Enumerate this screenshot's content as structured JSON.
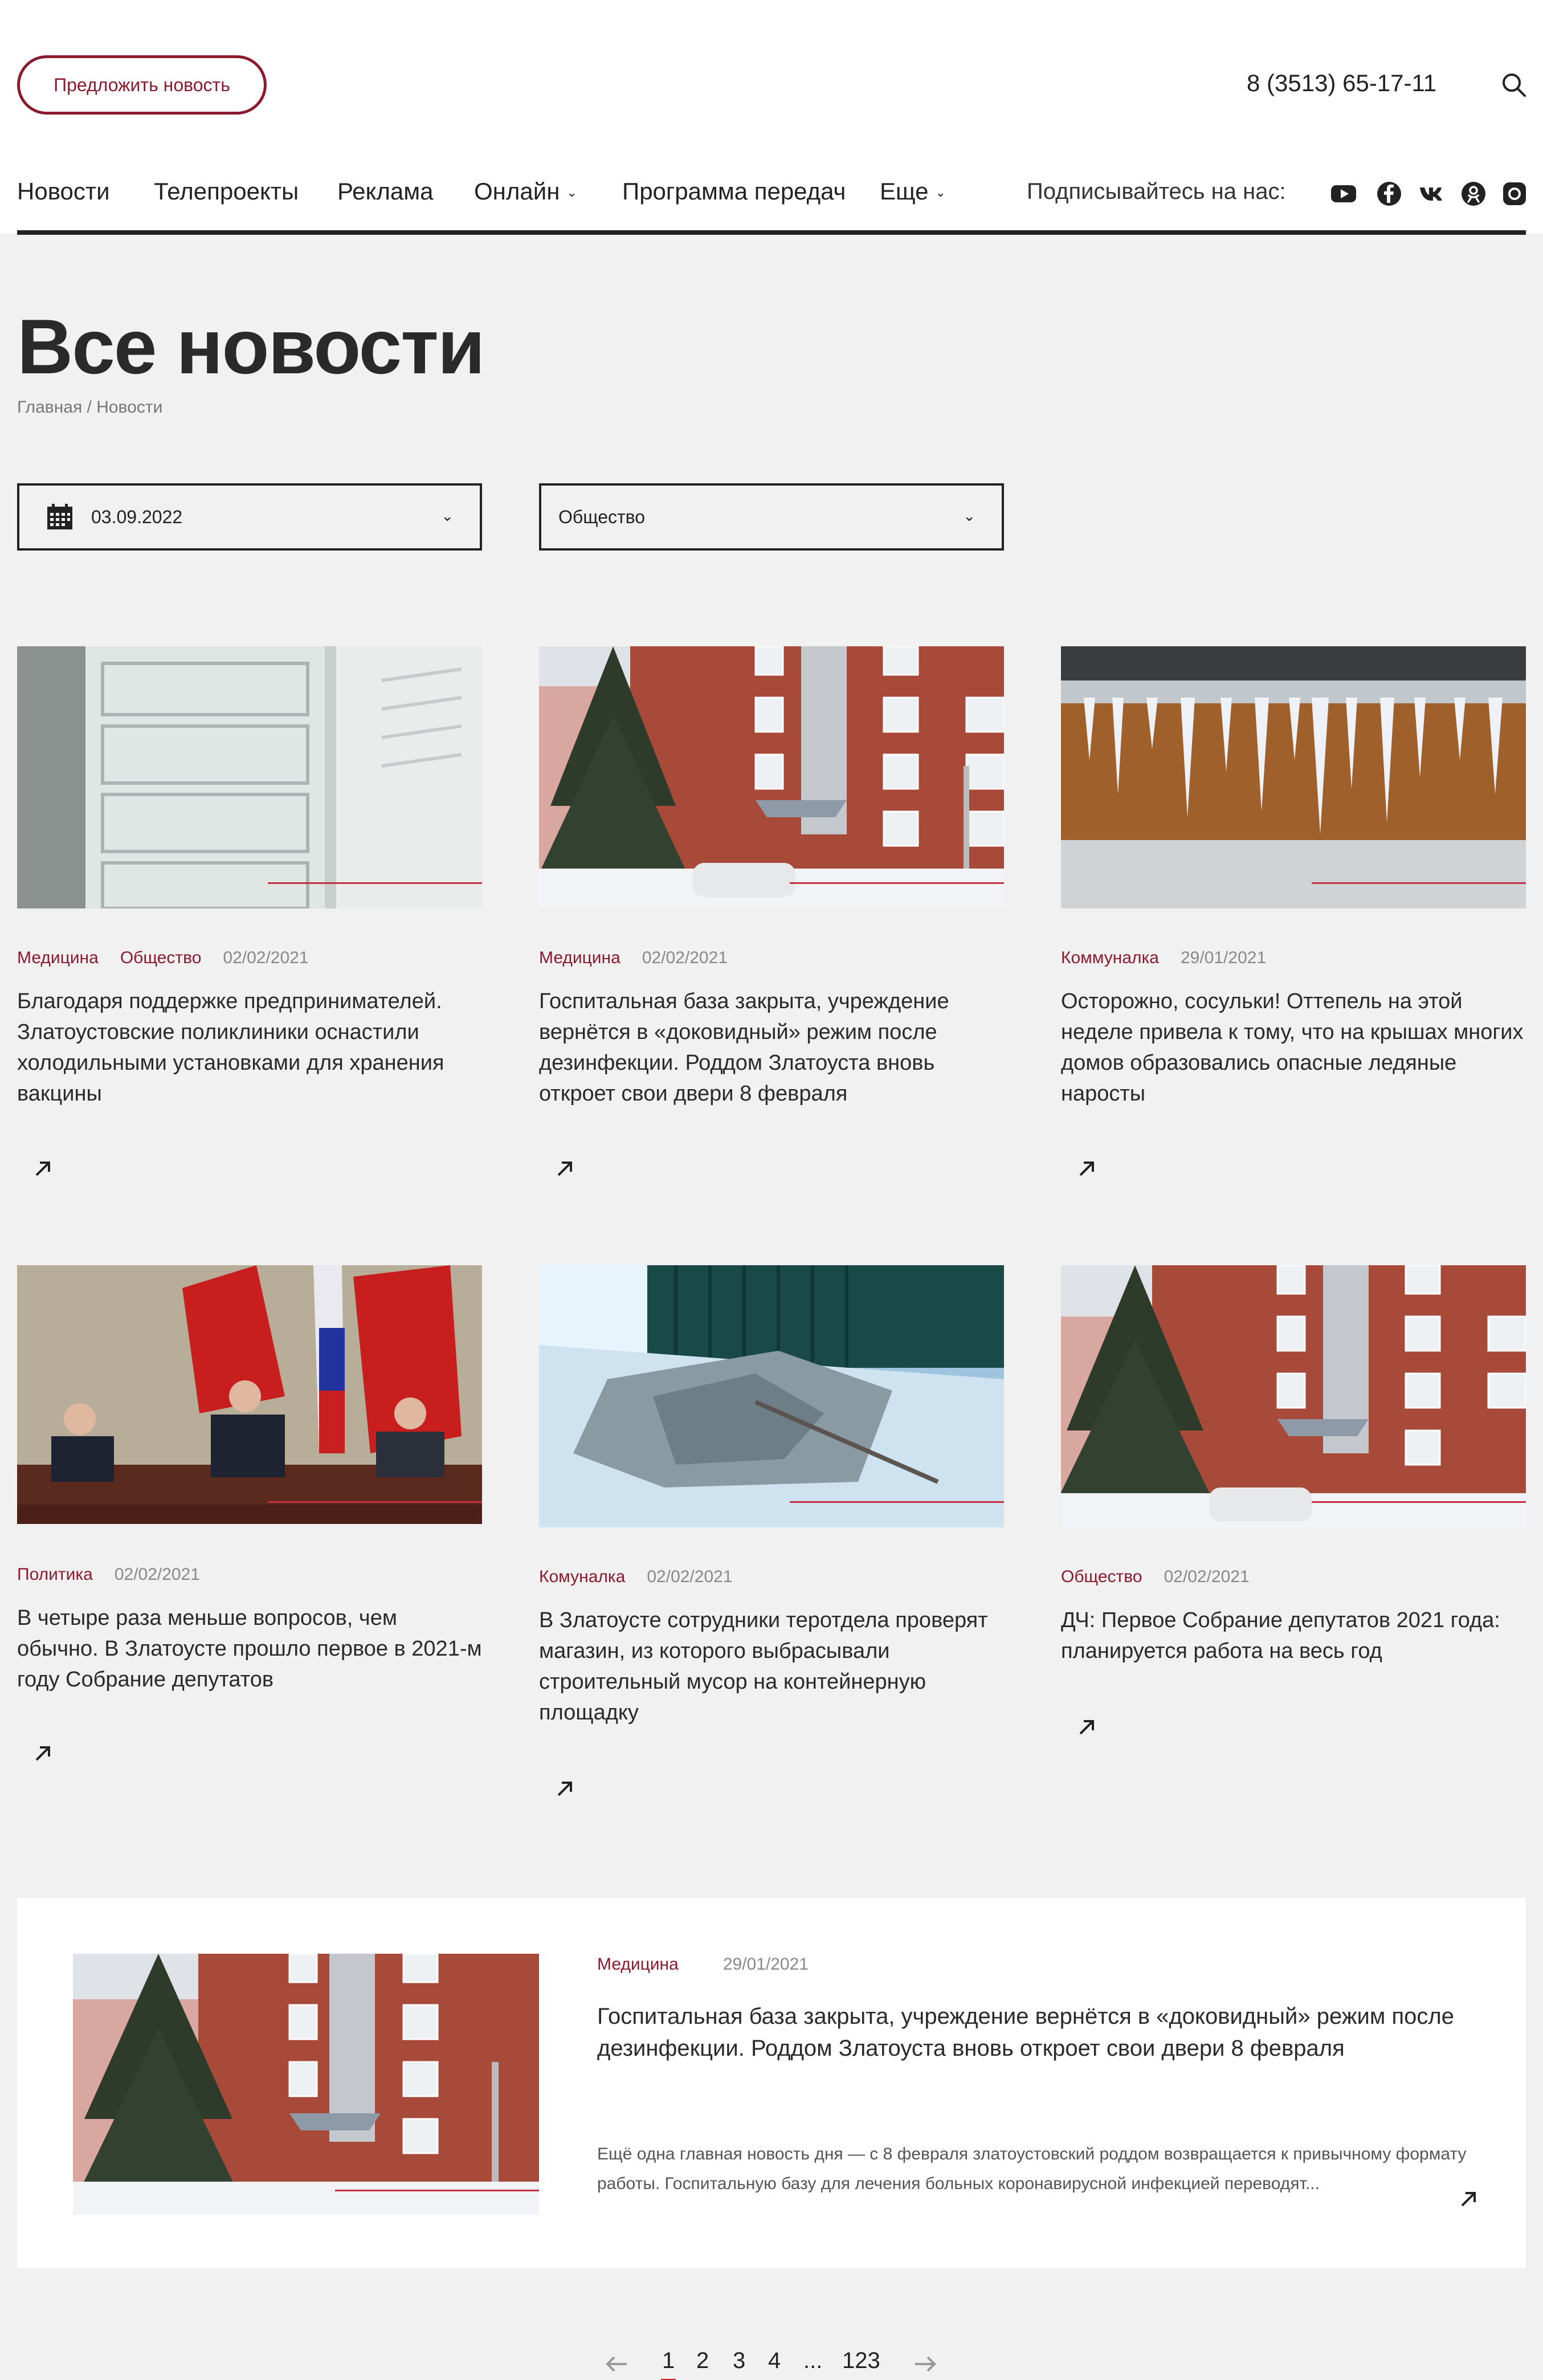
{
  "header": {
    "suggest_label": "Предложить новость",
    "phone": "8 (3513) 65-17-11"
  },
  "nav": {
    "items": [
      {
        "label": "Новости"
      },
      {
        "label": "Телепроекты"
      },
      {
        "label": "Реклама"
      },
      {
        "label": "Онлайн"
      },
      {
        "label": "Программа передач"
      },
      {
        "label": "Еще"
      }
    ],
    "subscribe_label": "Подписывайтесь на нас:",
    "socials": [
      "youtube-icon",
      "facebook-icon",
      "vk-icon",
      "odnoklassniki-icon",
      "instagram-icon"
    ]
  },
  "page": {
    "title": "Все новости",
    "breadcrumb": "Главная / Новости"
  },
  "filters": {
    "date_value": "03.09.2022",
    "category_value": "Общество"
  },
  "cards": [
    {
      "tags": [
        "Медицина",
        "Общество"
      ],
      "date": "02/02/2021",
      "title": "Благодаря поддержке предпринимателей. Златоустовские поликлиники оснастили холодильными установками для хранения вакцины"
    },
    {
      "tags": [
        "Медицина"
      ],
      "date": "02/02/2021",
      "title": "Госпитальная база закрыта, учреждение вернётся в «доковидный» режим после дезинфекции. Роддом Златоуста вновь откроет свои двери 8 февраля"
    },
    {
      "tags": [
        "Коммуналка"
      ],
      "date": "29/01/2021",
      "title": "Осторожно, сосульки! Оттепель на этой неделе привела к тому, что на крышах многих домов образовались опасные ледяные наросты"
    },
    {
      "tags": [
        "Политика"
      ],
      "date": "02/02/2021",
      "title": "В четыре раза меньше вопросов, чем обычно. В Златоусте прошло первое в 2021-м году Собрание депутатов"
    },
    {
      "tags": [
        "Комуналка"
      ],
      "date": "02/02/2021",
      "title": "В Златоусте сотрудники теротдела проверят магазин, из которого выбрасывали строительный мусор на контейнерную площадку"
    },
    {
      "tags": [
        "Общество"
      ],
      "date": "02/02/2021",
      "title": "ДЧ: Первое Собрание депутатов 2021 года: планируется работа на весь год"
    }
  ],
  "feature": {
    "tag": "Медицина",
    "date": "29/01/2021",
    "title": "Госпитальная база закрыта, учреждение вернётся в «доковидный» режим после дезинфекции. Роддом Златоуста вновь откроет свои двери 8 февраля",
    "description": "Ещё одна главная новость дня — с 8 февраля златоустовский роддом возвращается к привычному формату работы. Госпитальную базу для лечения больных коронавирусной инфекцией переводят..."
  },
  "pagination": {
    "pages": [
      "1",
      "2",
      "3",
      "4",
      "...",
      "123"
    ],
    "current": "1"
  },
  "colors": {
    "accent": "#8a1a2e",
    "background": "#f1f1f1",
    "text": "#222222"
  }
}
